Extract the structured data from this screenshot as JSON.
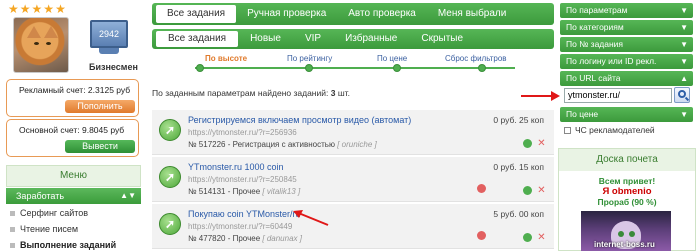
{
  "colors": {
    "accent_green": "#4fae4f",
    "orange": "#e07a2c",
    "link_blue": "#2a5aa8",
    "red_arrow": "#e01818"
  },
  "profile": {
    "stars": 5,
    "level_number": "2942",
    "level_name": "Бизнесмен",
    "ad_balance_label": "Рекламный счет: 2.3125 руб",
    "topup_label": "Пополнить",
    "main_balance_label": "Основной счет: 9.8045 руб",
    "withdraw_label": "Вывести"
  },
  "menu": {
    "title": "Меню",
    "section": "Заработать",
    "items": [
      {
        "label": "Серфинг сайтов",
        "bold": false
      },
      {
        "label": "Чтение писем",
        "bold": false
      },
      {
        "label": "Выполнение заданий",
        "bold": true
      }
    ]
  },
  "tabs_top": [
    "Все задания",
    "Ручная проверка",
    "Авто проверка",
    "Меня выбрали"
  ],
  "tabs_sub": [
    "Все задания",
    "Новые",
    "VIP",
    "Избранные",
    "Скрытые"
  ],
  "sort": [
    "По высоте",
    "По рейтингу",
    "По цене",
    "Сброс фильтров"
  ],
  "found": {
    "prefix": "По заданным параметрам найдено заданий:",
    "count": "3",
    "suffix": "шт."
  },
  "tasks": [
    {
      "title": "Регистрируемся включаем просмотр видео (автомат)",
      "url": "https://ytmonster.ru/?r=256936",
      "meta": "№ 517226 - Регистрация с активностью",
      "user": "[ oruniche ]",
      "price": "0 руб. 25 коп"
    },
    {
      "title": "YTmonster.ru 1000 coin",
      "url": "https://ytmonster.ru/?r=250845",
      "meta": "№ 514131 - Прочее",
      "user": "[ vitalik13 ]",
      "price": "0 руб. 15 коп"
    },
    {
      "title": "Покупаю coin YTMonster/ru",
      "url": "https://ytmonster.ru/?r=60449",
      "meta": "№ 477820 - Прочее",
      "user": "[ danunax ]",
      "price": "5 руб. 00 коп"
    }
  ],
  "filters": [
    "По параметрам",
    "По категориям",
    "По № задания",
    "По логину или ID рекл.",
    "По URL сайта"
  ],
  "url_filter_value": "ytmonster.ru/",
  "price_filter": "По цене",
  "chs_label": "ЧС рекламодателей",
  "board": {
    "title": "Доска почета",
    "greeting": "Всем привет!",
    "username": "Я obmenio",
    "rank": "Прораб (90 %)"
  },
  "watermark": "internet-boss.ru"
}
